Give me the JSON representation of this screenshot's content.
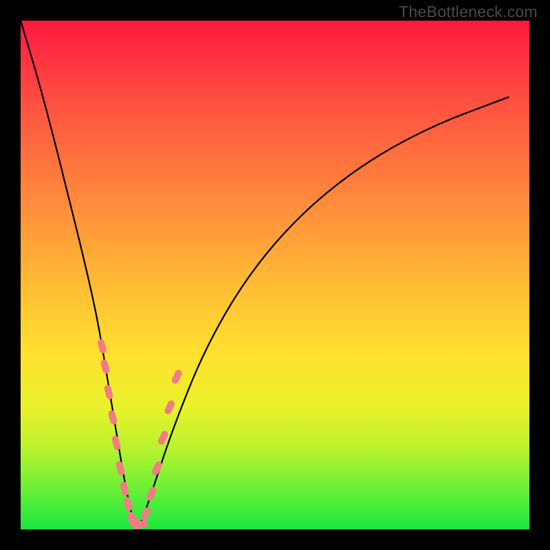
{
  "watermark": "TheBottleneck.com",
  "chart_data": {
    "type": "line",
    "title": "",
    "xlabel": "",
    "ylabel": "",
    "xlim": [
      0,
      100
    ],
    "ylim": [
      0,
      100
    ],
    "series": [
      {
        "name": "bottleneck-curve",
        "x": [
          0,
          3,
          6,
          9,
          12,
          15,
          17,
          19,
          20.5,
          22,
          23,
          24,
          26,
          30,
          36,
          44,
          54,
          66,
          80,
          96
        ],
        "y": [
          100,
          90,
          79,
          67,
          55,
          42,
          30,
          18,
          9,
          2,
          0,
          2,
          8,
          20,
          35,
          49,
          61,
          71,
          79,
          85
        ]
      }
    ],
    "markers": {
      "name": "highlight-dots",
      "color": "#f27b84",
      "points_xy": [
        [
          16.0,
          36
        ],
        [
          16.6,
          32
        ],
        [
          17.3,
          27
        ],
        [
          18.1,
          22
        ],
        [
          18.8,
          17
        ],
        [
          19.6,
          12
        ],
        [
          20.4,
          8
        ],
        [
          21.1,
          5
        ],
        [
          21.9,
          2
        ],
        [
          22.7,
          1
        ],
        [
          23.6,
          1
        ],
        [
          24.6,
          3
        ],
        [
          25.7,
          7
        ],
        [
          26.8,
          12
        ],
        [
          28.0,
          18
        ],
        [
          29.3,
          24
        ],
        [
          30.7,
          30
        ]
      ]
    }
  }
}
